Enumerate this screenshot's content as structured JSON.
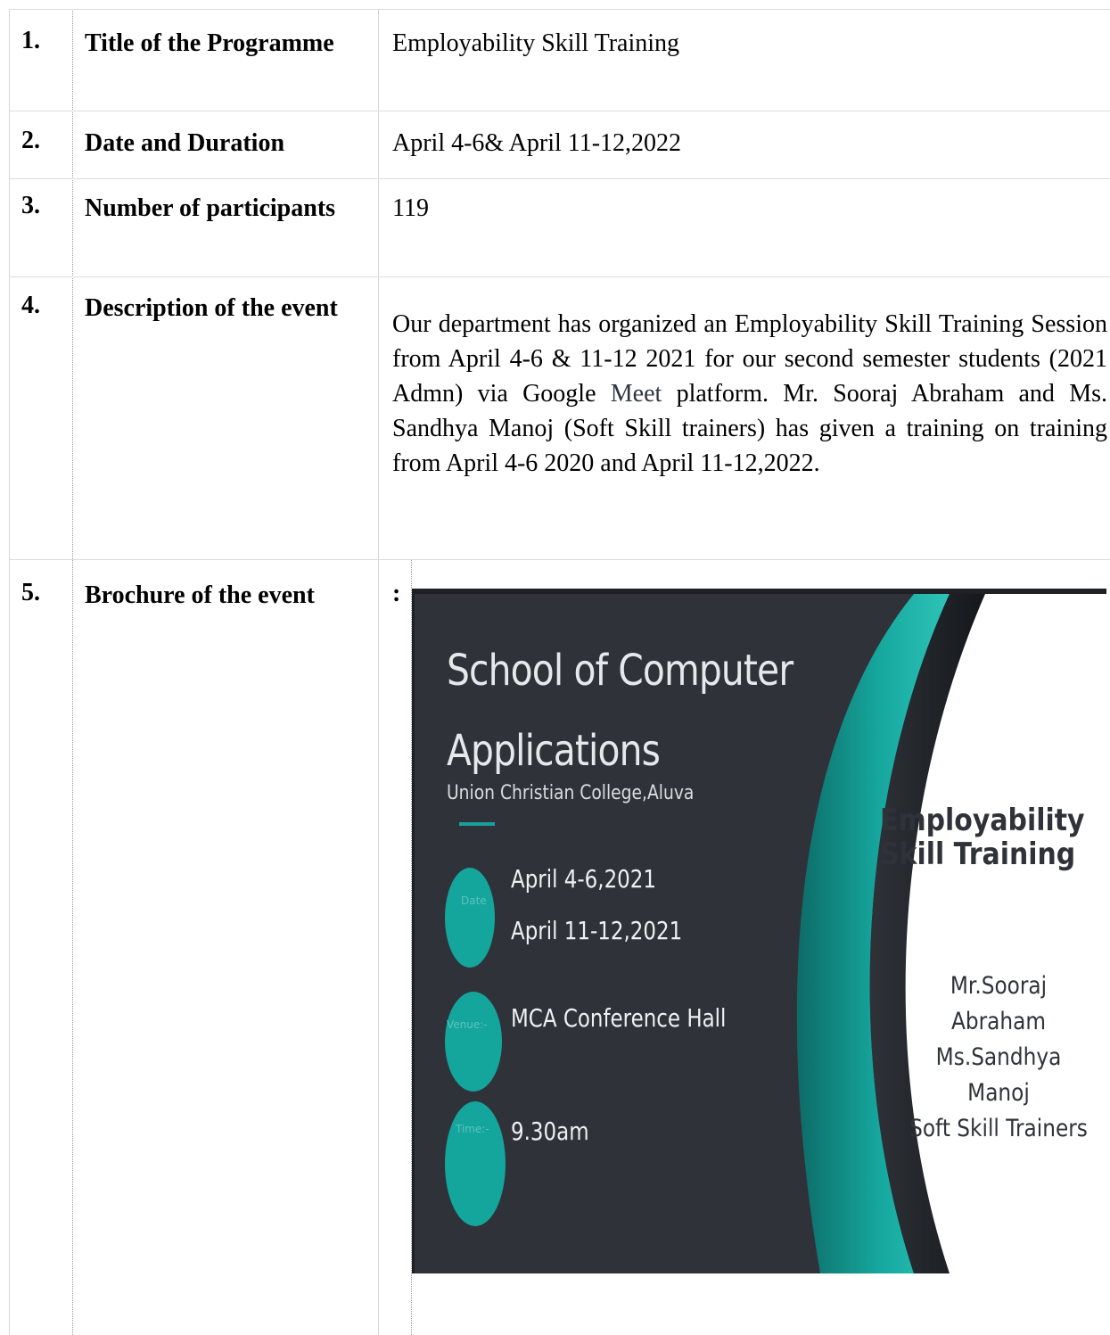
{
  "rows": [
    {
      "num": "1.",
      "label": "Title of the Programme",
      "value": "Employability Skill Training"
    },
    {
      "num": "2.",
      "label": "Date and Duration",
      "value": "April 4-6& April 11-12,2022"
    },
    {
      "num": "3.",
      "label": "Number of participants",
      "value": "119"
    },
    {
      "num": "4.",
      "label": "Description of the event",
      "value_part1": "Our department has organized an Employability Skill Training Session from April 4-6 & 11-12 2021 for our second semester students (2021 Admn) via Google ",
      "value_link": "Meet",
      "value_part2": " platform. Mr. Sooraj Abraham and Ms. Sandhya Manoj (Soft Skill trainers) has given a training on training from April 4-6 2020 and April 11-12,2022."
    },
    {
      "num": "5.",
      "label": "Brochure of the event",
      "value": ":"
    }
  ],
  "brochure": {
    "title_line1": "School of Computer",
    "title_line2": "Applications",
    "college": "Union Christian College,Aluva",
    "date_label": "Date",
    "date_line1": "April 4-6,2021",
    "date_line2": "April 11-12,2021",
    "venue_label": "Venue:-",
    "venue": "MCA Conference Hall",
    "time_label": "Time:-",
    "time": "9.30am",
    "event_line1": "Employability",
    "event_line2": "Skill Training",
    "trainer1": "Mr.Sooraj Abraham",
    "trainer2": "Ms.Sandhya Manoj",
    "trainer_role": "Soft Skill Trainers",
    "colors": {
      "background": "#2f3339",
      "accent": "#14a59c",
      "panel": "#ffffff"
    }
  }
}
